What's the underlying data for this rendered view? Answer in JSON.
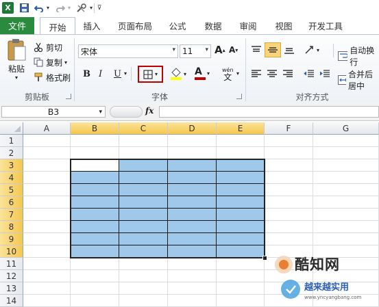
{
  "tabs": [
    {
      "label": "文件"
    },
    {
      "label": "开始"
    },
    {
      "label": "插入"
    },
    {
      "label": "页面布局"
    },
    {
      "label": "公式"
    },
    {
      "label": "数据"
    },
    {
      "label": "审阅"
    },
    {
      "label": "视图"
    },
    {
      "label": "开发工具"
    }
  ],
  "clipboard": {
    "paste_label": "粘贴",
    "cut_label": "剪切",
    "copy_label": "复制",
    "format_painter_label": "格式刷",
    "group_label": "剪贴板"
  },
  "font": {
    "font_name": "宋体",
    "font_size": "11",
    "bold": "B",
    "italic": "I",
    "underline": "U",
    "grow": "A",
    "shrink": "A",
    "font_color_letter": "A",
    "phonetic": "wén",
    "group_label": "字体"
  },
  "alignment": {
    "wrap_label": "自动换行",
    "merge_label": "合并后居中",
    "group_label": "对齐方式"
  },
  "formula_bar": {
    "name_box": "B3",
    "fx": "fx",
    "formula": ""
  },
  "columns": [
    "A",
    "B",
    "C",
    "D",
    "E",
    "F",
    "G"
  ],
  "rows": [
    "1",
    "2",
    "3",
    "4",
    "5",
    "6",
    "7",
    "8",
    "9",
    "10",
    "11",
    "12",
    "13",
    "14"
  ],
  "selection": {
    "active_cell": "B3",
    "range": "B3:E10"
  },
  "watermark": {
    "brand": "酷知网",
    "sub": "越来越实用",
    "url": "www.yncyangbang.com"
  },
  "colors": {
    "accent": "#2a8a3e",
    "fill": "#9fc8ea",
    "highlight": "#c00000",
    "header_sel": "#f5c74e"
  }
}
